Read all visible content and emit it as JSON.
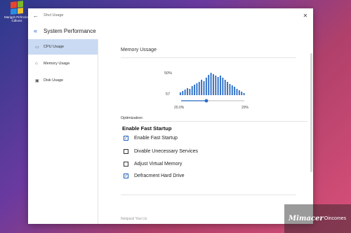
{
  "desktop": {
    "icon_name": "windows-logo-icon",
    "icon_caption": "Marigyh Pirhnclon Cdkoss",
    "logo_colors": [
      "#e8452c",
      "#7ab82c",
      "#2b8ce0",
      "#f2c12e"
    ]
  },
  "window": {
    "title": "Shct Usage",
    "back_icon": "←",
    "close_icon": "✕",
    "heading": "System Performance",
    "heading_icon": "«"
  },
  "sidebar": {
    "items": [
      {
        "label": "CPU Usage",
        "icon": "▭",
        "active": true
      },
      {
        "label": "Memory Usage",
        "icon": "⌂",
        "active": false
      },
      {
        "label": "Disk Usage",
        "icon": "▣",
        "active": false
      }
    ]
  },
  "memory": {
    "title": "Memory Ussage",
    "top_label": "50%",
    "mid_label": "57",
    "slider_left": "20.0%",
    "slider_right": "20%",
    "slider_value_fraction": 0.4,
    "accent": "#2a6cc4"
  },
  "chart_data": {
    "type": "bar",
    "values": [
      4,
      6,
      8,
      10,
      9,
      13,
      15,
      17,
      19,
      22,
      20,
      25,
      29,
      32,
      30,
      28,
      26,
      28,
      25,
      22,
      19,
      16,
      14,
      12,
      9,
      7,
      5,
      3
    ],
    "ylim": [
      0,
      34
    ],
    "ticks": [
      {
        "label": "50%",
        "value": 30
      },
      {
        "label": "57",
        "value": 4
      }
    ],
    "color": "#2a6cc4"
  },
  "optimization": {
    "label": "Optimization:",
    "title": "Enable Fast Startup",
    "options": [
      {
        "label": "Enable Fast Startup",
        "checked": true
      },
      {
        "label": "Divable Unecessary Services",
        "checked": false
      },
      {
        "label": "Adjust Virtual Memory",
        "checked": false
      },
      {
        "label": "Defracment Hard Drive",
        "checked": true
      }
    ]
  },
  "footnote": "Netipizal Yow Us",
  "watermark": {
    "brand": "Mimacer",
    "text": "Oincomes"
  }
}
